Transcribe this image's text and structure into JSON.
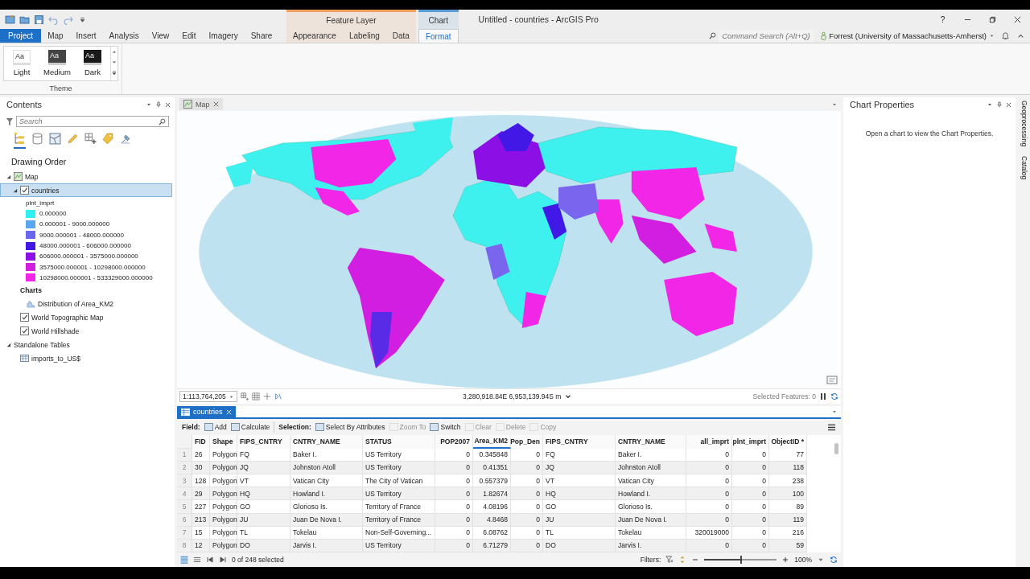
{
  "window": {
    "title": "Untitled - countries - ArcGIS Pro",
    "help": "?"
  },
  "ribbon": {
    "tabs": [
      {
        "label": "Project",
        "kind": "backstage",
        "selected": false
      },
      {
        "label": "Map",
        "kind": "tab",
        "selected": false
      },
      {
        "label": "Insert",
        "kind": "tab",
        "selected": false
      },
      {
        "label": "Analysis",
        "kind": "tab",
        "selected": false
      },
      {
        "label": "View",
        "kind": "tab",
        "selected": false
      },
      {
        "label": "Edit",
        "kind": "tab",
        "selected": false
      },
      {
        "label": "Imagery",
        "kind": "tab",
        "selected": false
      },
      {
        "label": "Share",
        "kind": "tab",
        "selected": false
      }
    ],
    "contextual_groups": [
      {
        "title": "Feature Layer",
        "color": "#f0a060",
        "tabs": [
          {
            "label": "Appearance",
            "selected": false
          },
          {
            "label": "Labeling",
            "selected": false
          },
          {
            "label": "Data",
            "selected": false
          }
        ]
      },
      {
        "title": "Chart",
        "color": "#5b9bd5",
        "tabs": [
          {
            "label": "Format",
            "selected": true
          }
        ]
      }
    ],
    "command_search": {
      "placeholder": "Command Search (Alt+Q)"
    },
    "user": "Forrest (University of Massachusetts-Amherst)",
    "theme_group": {
      "title": "Theme",
      "options": [
        {
          "label": "Light",
          "sample": "Aa",
          "kind": "light",
          "selected": false
        },
        {
          "label": "Medium",
          "sample": "Aa",
          "kind": "medium",
          "selected": false
        },
        {
          "label": "Dark",
          "sample": "Aa",
          "kind": "dark",
          "selected": false
        }
      ]
    }
  },
  "contents": {
    "title": "Contents",
    "search": {
      "placeholder": "Search"
    },
    "heading": "Drawing Order",
    "tree": [
      {
        "label": "Map",
        "kind": "map",
        "expanded": true,
        "selected": false,
        "children": [
          {
            "label": "countries",
            "kind": "layer",
            "expanded": true,
            "checked": true,
            "selected": true,
            "legend": {
              "field": "plnt_imprt",
              "classes": [
                {
                  "label": "0.000000",
                  "color": "#2ef0f0"
                },
                {
                  "label": "0.000001 - 9000.000000",
                  "color": "#5aa6f0"
                },
                {
                  "label": "9000.000001 - 48000.000000",
                  "color": "#6a66ee"
                },
                {
                  "label": "48000.000001 - 606000.000000",
                  "color": "#4218e6"
                },
                {
                  "label": "606000.000001 - 3575000.000000",
                  "color": "#8c10e6"
                },
                {
                  "label": "3575000.000001 - 10298000.000000",
                  "color": "#d21ee0"
                },
                {
                  "label": "10298000.000001 - 533329000.000000",
                  "color": "#f424e8"
                }
              ]
            }
          },
          {
            "label": "Charts",
            "kind": "heading",
            "selected": false,
            "children": [
              {
                "label": "Distribution of Area_KM2",
                "kind": "chart",
                "selected": false
              }
            ]
          },
          {
            "label": "World Topographic Map",
            "kind": "layer",
            "checked": true,
            "selected": false
          },
          {
            "label": "World Hillshade",
            "kind": "layer",
            "checked": true,
            "selected": false
          }
        ]
      },
      {
        "label": "Standalone Tables",
        "kind": "group",
        "expanded": true,
        "selected": false,
        "children": [
          {
            "label": "imports_to_US$",
            "kind": "table",
            "selected": false
          }
        ]
      }
    ]
  },
  "map_view": {
    "tab": "Map",
    "scale": "1:113,764,205",
    "coordinates": "3,280,918.84E 6,953,139.94S m",
    "selected_features": "Selected Features: 0"
  },
  "table_view": {
    "tab": "countries",
    "field_tools": {
      "label": "Field:",
      "buttons": [
        {
          "label": "Add",
          "disabled": false
        },
        {
          "label": "Calculate",
          "disabled": false
        }
      ]
    },
    "selection_tools": {
      "label": "Selection:",
      "buttons": [
        {
          "label": "Select By Attributes",
          "disabled": false
        },
        {
          "label": "Zoom To",
          "disabled": true
        },
        {
          "label": "Switch",
          "disabled": false
        },
        {
          "label": "Clear",
          "disabled": true
        },
        {
          "label": "Delete",
          "disabled": true
        },
        {
          "label": "Copy",
          "disabled": true
        }
      ]
    },
    "columns": [
      {
        "label": "FID",
        "numeric": false,
        "selected": false
      },
      {
        "label": "Shape",
        "numeric": false,
        "selected": false
      },
      {
        "label": "FIPS_CNTRY",
        "numeric": false,
        "selected": false
      },
      {
        "label": "CNTRY_NAME",
        "numeric": false,
        "selected": false
      },
      {
        "label": "STATUS",
        "numeric": false,
        "selected": false
      },
      {
        "label": "POP2007",
        "numeric": true,
        "selected": false
      },
      {
        "label": "Area_KM2",
        "numeric": true,
        "selected": true
      },
      {
        "label": "Pop_Den",
        "numeric": true,
        "selected": false
      },
      {
        "label": "FIPS_CNTRY",
        "numeric": false,
        "selected": false
      },
      {
        "label": "CNTRY_NAME",
        "numeric": false,
        "selected": false
      },
      {
        "label": "all_imprt",
        "numeric": true,
        "selected": false
      },
      {
        "label": "plnt_imprt",
        "numeric": true,
        "selected": false
      },
      {
        "label": "ObjectID *",
        "numeric": true,
        "selected": false
      }
    ],
    "rows": [
      {
        "number": "1",
        "cells": [
          "26",
          "Polygon",
          "FQ",
          "Baker I.",
          "US Territory",
          "0",
          "0.345848",
          "0",
          "FQ",
          "Baker I.",
          "0",
          "0",
          "77"
        ]
      },
      {
        "number": "2",
        "cells": [
          "30",
          "Polygon",
          "JQ",
          "Johnston Atoll",
          "US Territory",
          "0",
          "0.41351",
          "0",
          "JQ",
          "Johnston Atoll",
          "0",
          "0",
          "118"
        ]
      },
      {
        "number": "3",
        "cells": [
          "128",
          "Polygon",
          "VT",
          "Vatican City",
          "The City of Vatican",
          "0",
          "0.557379",
          "0",
          "VT",
          "Vatican City",
          "0",
          "0",
          "238"
        ]
      },
      {
        "number": "4",
        "cells": [
          "29",
          "Polygon",
          "HQ",
          "Howland I.",
          "US Territory",
          "0",
          "1.82674",
          "0",
          "HQ",
          "Howland I.",
          "0",
          "0",
          "100"
        ]
      },
      {
        "number": "5",
        "cells": [
          "227",
          "Polygon",
          "GO",
          "Glorioso Is.",
          "Territory of France",
          "0",
          "4.08196",
          "0",
          "GO",
          "Glorioso Is.",
          "0",
          "0",
          "89"
        ]
      },
      {
        "number": "6",
        "cells": [
          "213",
          "Polygon",
          "JU",
          "Juan De Nova I.",
          "Territory of France",
          "0",
          "4.8468",
          "0",
          "JU",
          "Juan De Nova I.",
          "0",
          "0",
          "119"
        ]
      },
      {
        "number": "7",
        "cells": [
          "15",
          "Polygon",
          "TL",
          "Tokelau",
          "Non-Self-Governing...",
          "0",
          "6.08762",
          "0",
          "TL",
          "Tokelau",
          "320019000",
          "0",
          "216"
        ]
      },
      {
        "number": "8",
        "cells": [
          "12",
          "Polygon",
          "DO",
          "Jarvis I.",
          "US Territory",
          "0",
          "6.71279",
          "0",
          "DO",
          "Jarvis I.",
          "0",
          "0",
          "59"
        ]
      }
    ],
    "selection_count": "0 of 248 selected",
    "filters_label": "Filters:",
    "zoom": {
      "level": 0.5,
      "reading": "100%"
    }
  },
  "chart_properties": {
    "title": "Chart Properties",
    "message": "Open a chart to view the Chart Properties."
  },
  "side_tabs": [
    {
      "label": "Geoprocessing",
      "selected": false
    },
    {
      "label": "Catalog",
      "selected": false
    }
  ]
}
